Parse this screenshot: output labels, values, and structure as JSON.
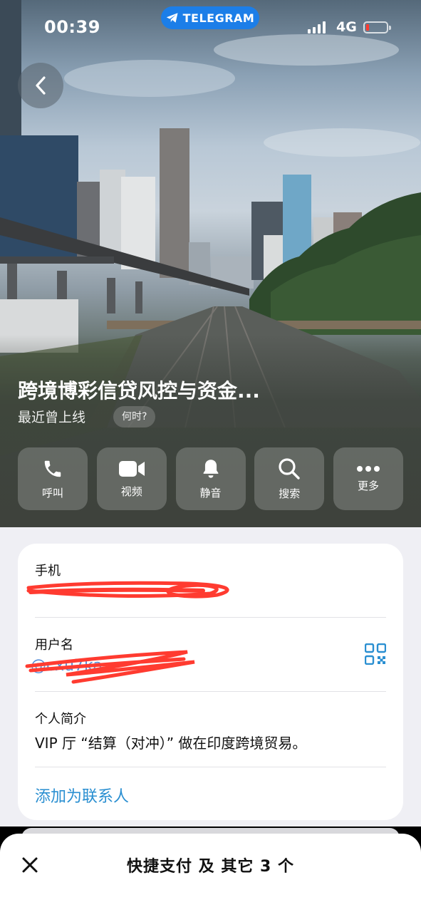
{
  "status_bar": {
    "time": "00:39",
    "app_pill": "TELEGRAM",
    "network": "4G"
  },
  "profile": {
    "name": "跨境博彩信贷风控与资金...",
    "last_seen": "最近曾上线",
    "when_badge": "何时?"
  },
  "actions": [
    {
      "label": "呼叫",
      "icon": "phone-icon"
    },
    {
      "label": "视频",
      "icon": "video-icon"
    },
    {
      "label": "静音",
      "icon": "bell-icon"
    },
    {
      "label": "搜索",
      "icon": "search-icon"
    },
    {
      "label": "更多",
      "icon": "more-icon"
    }
  ],
  "info": {
    "phone_title": "手机",
    "username_title": "用户名",
    "bio_title": "个人简介",
    "bio_text": "VIP 厅 “结算（对冲）” 做在印度跨境贸易。",
    "add_contact": "添加为联系人"
  },
  "bottom_sheet": {
    "title": "快捷支付 及 其它 3 个"
  },
  "colors": {
    "accent": "#2a8fd1",
    "telegram_blue": "#1c7ee8",
    "redaction": "#ff3b30"
  }
}
